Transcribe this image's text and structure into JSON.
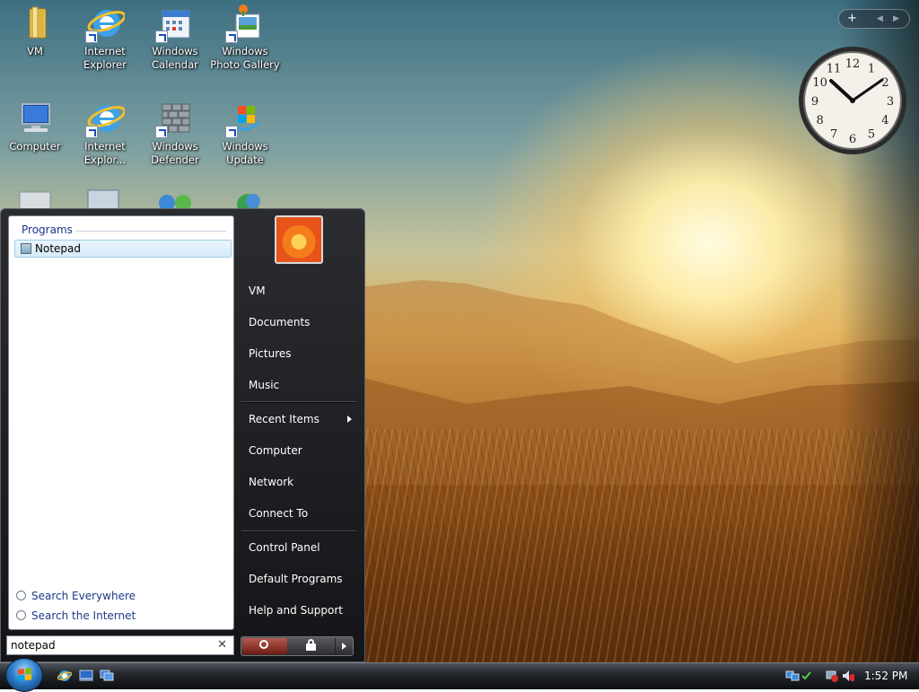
{
  "desktop": {
    "icons": [
      {
        "label": "VM",
        "icon": "folder-icon"
      },
      {
        "label": "Internet Explorer",
        "icon": "internet-explorer-icon"
      },
      {
        "label": "Windows Calendar",
        "icon": "calendar-icon"
      },
      {
        "label": "Windows Photo Gallery",
        "icon": "photo-gallery-icon"
      },
      {
        "label": "Computer",
        "icon": "computer-icon"
      },
      {
        "label": "Internet Explor...",
        "icon": "internet-explorer-icon"
      },
      {
        "label": "Windows Defender",
        "icon": "defender-icon"
      },
      {
        "label": "Windows Update",
        "icon": "windows-update-icon"
      }
    ],
    "clock": {
      "hours": [
        "12",
        "1",
        "2",
        "3",
        "4",
        "5",
        "6",
        "7",
        "8",
        "9",
        "10",
        "11"
      ]
    }
  },
  "start_menu": {
    "programs_heading": "Programs",
    "results": [
      {
        "label": "Notepad",
        "icon": "notepad-icon"
      }
    ],
    "search_links": [
      "Search Everywhere",
      "Search the Internet"
    ],
    "search": {
      "value": "notepad",
      "clear": "✕"
    },
    "right_items": [
      "VM",
      "Documents",
      "Pictures",
      "Music",
      "Recent Items",
      "Computer",
      "Network",
      "Connect To",
      "Control Panel",
      "Default Programs",
      "Help and Support"
    ]
  },
  "taskbar": {
    "time": "1:52 PM"
  },
  "sidebar_controls": {
    "add": "+",
    "prev": "◀",
    "next": "▶"
  }
}
